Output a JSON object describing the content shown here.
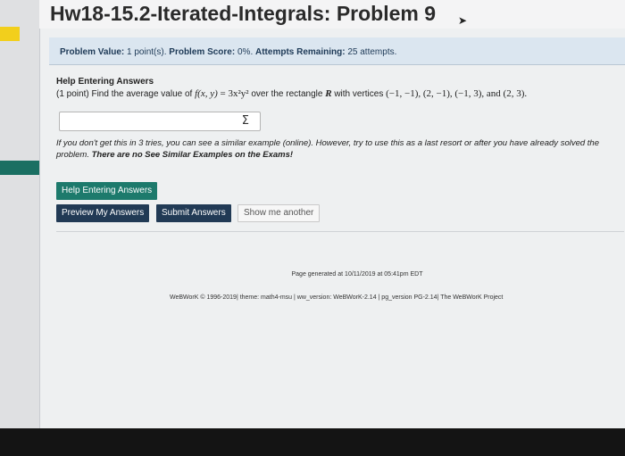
{
  "page": {
    "title": "Hw18-15.2-Iterated-Integrals: Problem 9"
  },
  "problem_info": {
    "value_label": "Problem Value:",
    "value_text": "1 point(s).",
    "score_label": "Problem Score:",
    "score_text": "0%.",
    "attempts_label": "Attempts Remaining:",
    "attempts_text": "25 attempts."
  },
  "problem": {
    "help_heading": "Help Entering Answers",
    "points_prefix": "(1 point) Find the average value of",
    "function_lhs": "f(x, y)",
    "function_eq": " = 3x²y²",
    "over_text": "over the rectangle",
    "region": "R",
    "vertices_prefix": "with vertices",
    "vertices": "(−1, −1), (2, −1), (−1, 3), and (2, 3)."
  },
  "answer": {
    "value": "",
    "sigma_symbol": "Σ"
  },
  "hint": {
    "text": "If you don't get this in 3 tries, you can see a similar example (online). However, try to use this as a last resort or after you have already solved the problem.",
    "bold_text": "There are no See Similar Examples on the Exams!"
  },
  "buttons": {
    "help_entering": "Help Entering Answers",
    "preview": "Preview My Answers",
    "submit": "Submit Answers",
    "show_another": "Show me another"
  },
  "footer": {
    "generated": "Page generated at 10/11/2019 at 05:41pm EDT",
    "credits": "WeBWorK © 1996-2019| theme: math4-msu | ww_version: WeBWorK-2.14 | pg_version PG-2.14| The WeBWorK Project"
  },
  "colors": {
    "teal": "#1d7a6c",
    "navy": "#213a55",
    "header_bg": "#dbe6f0",
    "yellow_tab": "#f2cf1c"
  }
}
